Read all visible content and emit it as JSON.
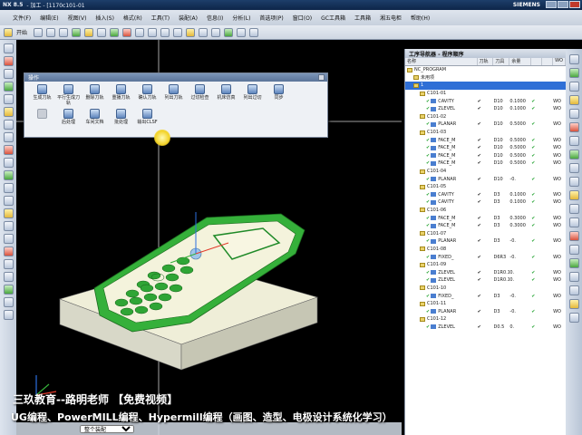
{
  "window": {
    "app_name": "NX 8.5",
    "title": "- 加工 - [1170c101-01",
    "brand": "SIEMENS"
  },
  "menubar": {
    "items": [
      "文件(F)",
      "编辑(E)",
      "视图(V)",
      "插入(S)",
      "格式(R)",
      "工具(T)",
      "装配(A)",
      "信息(I)",
      "分析(L)",
      "首选项(P)",
      "窗口(O)",
      "GC工具箱",
      "工具箱",
      "湘五电柜",
      "帮助(H)"
    ]
  },
  "toolbar": {
    "start_label": "开始",
    "views": [
      "",
      ""
    ]
  },
  "dialog": {
    "title": "操作",
    "row1": [
      "生成刀轨",
      "平行生成刀轨",
      "删除刀轨",
      "重播刀轨",
      "确认刀轨",
      "列出刀轨",
      "过切检查",
      "机床仿真",
      "列出过切",
      "同步"
    ],
    "row2": [
      "后处理",
      "车间文档",
      "批处理",
      "输出CLSF"
    ],
    "row2_dim": [
      "后处理(灰)"
    ]
  },
  "navigator": {
    "header": "工序导航器 - 程序顺序",
    "columns": [
      "名称",
      "刀轨",
      "刀具",
      "余量",
      "",
      "",
      "WO"
    ],
    "rows": [
      {
        "name": "NC_PROGRAM",
        "tv": "",
        "tool": "",
        "stock": "",
        "st": "",
        "st2": "",
        "wo": "",
        "level": 0,
        "kind": "root"
      },
      {
        "name": "未用项",
        "tv": "",
        "tool": "",
        "stock": "",
        "st": "",
        "st2": "",
        "wo": "",
        "level": 1,
        "kind": "grp"
      },
      {
        "name": "1",
        "tv": "",
        "tool": "",
        "stock": "",
        "st": "",
        "st2": "",
        "wo": "",
        "level": 1,
        "kind": "grp",
        "selected": true
      },
      {
        "name": "C101-01",
        "tv": "",
        "tool": "",
        "stock": "",
        "st": "",
        "st2": "",
        "wo": "",
        "level": 2,
        "kind": "grp"
      },
      {
        "name": "CAVITY",
        "tv": "✔",
        "tool": "D10",
        "stock": "0.1000",
        "st": "✔",
        "st2": "",
        "wo": "WO",
        "level": 3,
        "kind": "op"
      },
      {
        "name": "ZLEVEL",
        "tv": "✔",
        "tool": "D10",
        "stock": "0.1000",
        "st": "✔",
        "st2": "",
        "wo": "WO",
        "level": 3,
        "kind": "op"
      },
      {
        "name": "C101-02",
        "tv": "",
        "tool": "",
        "stock": "",
        "st": "",
        "st2": "",
        "wo": "",
        "level": 2,
        "kind": "grp"
      },
      {
        "name": "PLANAR",
        "tv": "✔",
        "tool": "D10",
        "stock": "0.5000",
        "st": "✔",
        "st2": "",
        "wo": "WO",
        "level": 3,
        "kind": "op"
      },
      {
        "name": "C101-03",
        "tv": "",
        "tool": "",
        "stock": "",
        "st": "",
        "st2": "",
        "wo": "",
        "level": 2,
        "kind": "grp"
      },
      {
        "name": "FACE_M",
        "tv": "✔",
        "tool": "D10",
        "stock": "0.5000",
        "st": "✔",
        "st2": "",
        "wo": "WO",
        "level": 3,
        "kind": "op"
      },
      {
        "name": "FACE_M",
        "tv": "✔",
        "tool": "D10",
        "stock": "0.5000",
        "st": "✔",
        "st2": "",
        "wo": "WO",
        "level": 3,
        "kind": "op"
      },
      {
        "name": "FACE_M",
        "tv": "✔",
        "tool": "D10",
        "stock": "0.5000",
        "st": "✔",
        "st2": "",
        "wo": "WO",
        "level": 3,
        "kind": "op"
      },
      {
        "name": "FACE_M",
        "tv": "✔",
        "tool": "D10",
        "stock": "0.5000",
        "st": "✔",
        "st2": "",
        "wo": "WO",
        "level": 3,
        "kind": "op"
      },
      {
        "name": "C101-04",
        "tv": "",
        "tool": "",
        "stock": "",
        "st": "",
        "st2": "",
        "wo": "",
        "level": 2,
        "kind": "grp"
      },
      {
        "name": "PLANAR",
        "tv": "✔",
        "tool": "D10",
        "stock": "-0.",
        "st": "✔",
        "st2": "",
        "wo": "WO",
        "level": 3,
        "kind": "op"
      },
      {
        "name": "C101-05",
        "tv": "",
        "tool": "",
        "stock": "",
        "st": "",
        "st2": "",
        "wo": "",
        "level": 2,
        "kind": "grp"
      },
      {
        "name": "CAVITY",
        "tv": "✔",
        "tool": "D3",
        "stock": "0.1000",
        "st": "✔",
        "st2": "",
        "wo": "WO",
        "level": 3,
        "kind": "op"
      },
      {
        "name": "CAVITY",
        "tv": "✔",
        "tool": "D3",
        "stock": "0.1000",
        "st": "✔",
        "st2": "",
        "wo": "WO",
        "level": 3,
        "kind": "op"
      },
      {
        "name": "C101-06",
        "tv": "",
        "tool": "",
        "stock": "",
        "st": "",
        "st2": "",
        "wo": "",
        "level": 2,
        "kind": "grp"
      },
      {
        "name": "FACE_M",
        "tv": "✔",
        "tool": "D3",
        "stock": "0.3000",
        "st": "✔",
        "st2": "",
        "wo": "WO",
        "level": 3,
        "kind": "op"
      },
      {
        "name": "FACE_M",
        "tv": "✔",
        "tool": "D3",
        "stock": "0.3000",
        "st": "✔",
        "st2": "",
        "wo": "WO",
        "level": 3,
        "kind": "op"
      },
      {
        "name": "C101-07",
        "tv": "",
        "tool": "",
        "stock": "",
        "st": "",
        "st2": "",
        "wo": "",
        "level": 2,
        "kind": "grp"
      },
      {
        "name": "PLANAR",
        "tv": "✔",
        "tool": "D3",
        "stock": "-0.",
        "st": "✔",
        "st2": "",
        "wo": "WO",
        "level": 3,
        "kind": "op"
      },
      {
        "name": "C101-08",
        "tv": "",
        "tool": "",
        "stock": "",
        "st": "",
        "st2": "",
        "wo": "",
        "level": 2,
        "kind": "grp"
      },
      {
        "name": "FIXED_",
        "tv": "✔",
        "tool": "D6R3",
        "stock": "-0.",
        "st": "✔",
        "st2": "",
        "wo": "WO",
        "level": 3,
        "kind": "op"
      },
      {
        "name": "C101-09",
        "tv": "",
        "tool": "",
        "stock": "",
        "st": "",
        "st2": "",
        "wo": "",
        "level": 2,
        "kind": "grp"
      },
      {
        "name": "ZLEVEL",
        "tv": "✔",
        "tool": "D1R0.1",
        "stock": "0.",
        "st": "✔",
        "st2": "",
        "wo": "WO",
        "level": 3,
        "kind": "op"
      },
      {
        "name": "ZLEVEL",
        "tv": "✔",
        "tool": "D1R0.1",
        "stock": "0.",
        "st": "✔",
        "st2": "",
        "wo": "WO",
        "level": 3,
        "kind": "op"
      },
      {
        "name": "C101-10",
        "tv": "",
        "tool": "",
        "stock": "",
        "st": "",
        "st2": "",
        "wo": "",
        "level": 2,
        "kind": "grp"
      },
      {
        "name": "FIXED_",
        "tv": "✔",
        "tool": "D3",
        "stock": "-0.",
        "st": "✔",
        "st2": "",
        "wo": "WO",
        "level": 3,
        "kind": "op"
      },
      {
        "name": "C101-11",
        "tv": "",
        "tool": "",
        "stock": "",
        "st": "",
        "st2": "",
        "wo": "",
        "level": 2,
        "kind": "grp"
      },
      {
        "name": "PLANAR",
        "tv": "✔",
        "tool": "D3",
        "stock": "-0.",
        "st": "✔",
        "st2": "",
        "wo": "WO",
        "level": 3,
        "kind": "op"
      },
      {
        "name": "C101-12",
        "tv": "",
        "tool": "",
        "stock": "",
        "st": "",
        "st2": "",
        "wo": "",
        "level": 2,
        "kind": "grp"
      },
      {
        "name": "ZLEVEL",
        "tv": "✔",
        "tool": "D0.5",
        "stock": "0.",
        "st": "✔",
        "st2": "",
        "wo": "WO",
        "level": 3,
        "kind": "op"
      }
    ]
  },
  "statusbar": {
    "filter_value": "整个装配"
  },
  "watermark": {
    "line1": "三玖教育--路明老师  【免费视频】",
    "line2": "UG编程、PowerMILL编程、Hypermill编程（画图、造型、电极设计系统化学习）"
  },
  "colors": {
    "model_green": "#35b03a",
    "model_face": "#f1f0d6",
    "selection_blue": "#2f6fd6"
  }
}
